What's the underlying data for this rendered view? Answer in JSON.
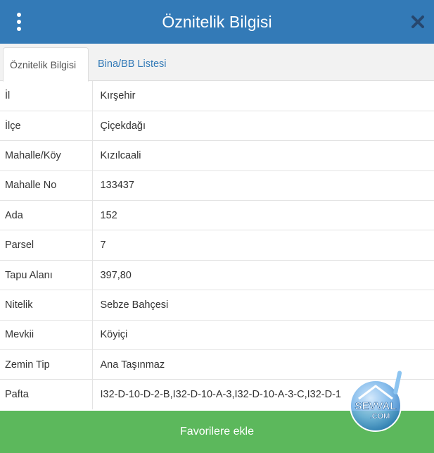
{
  "header": {
    "title": "Öznitelik Bilgisi"
  },
  "tabs": [
    {
      "label": "Öznitelik Bilgisi",
      "active": true
    },
    {
      "label": "Bina/BB Listesi",
      "active": false
    }
  ],
  "attributes": [
    {
      "key": "İl",
      "value": "Kırşehir"
    },
    {
      "key": "İlçe",
      "value": "Çiçekdağı"
    },
    {
      "key": "Mahalle/Köy",
      "value": "Kızılcaali"
    },
    {
      "key": "Mahalle No",
      "value": "133437"
    },
    {
      "key": "Ada",
      "value": "152"
    },
    {
      "key": "Parsel",
      "value": "7"
    },
    {
      "key": "Tapu Alanı",
      "value": "397,80"
    },
    {
      "key": "Nitelik",
      "value": "Sebze Bahçesi"
    },
    {
      "key": "Mevkii",
      "value": "Köyiçi"
    },
    {
      "key": "Zemin Tip",
      "value": "Ana Taşınmaz"
    },
    {
      "key": "Pafta",
      "value": "I32-D-10-D-2-B,I32-D-10-A-3,I32-D-10-A-3-C,I32-D-1"
    }
  ],
  "footer": {
    "button_label": "Favorilere ekle"
  },
  "watermark": {
    "line1": "SEVVAL",
    "line2": ".COM"
  },
  "colors": {
    "header": "#337ab7",
    "button": "#5cb85c",
    "link": "#337ab7"
  },
  "icons": {
    "menu": "vertical-dots-icon",
    "close": "close-icon"
  }
}
